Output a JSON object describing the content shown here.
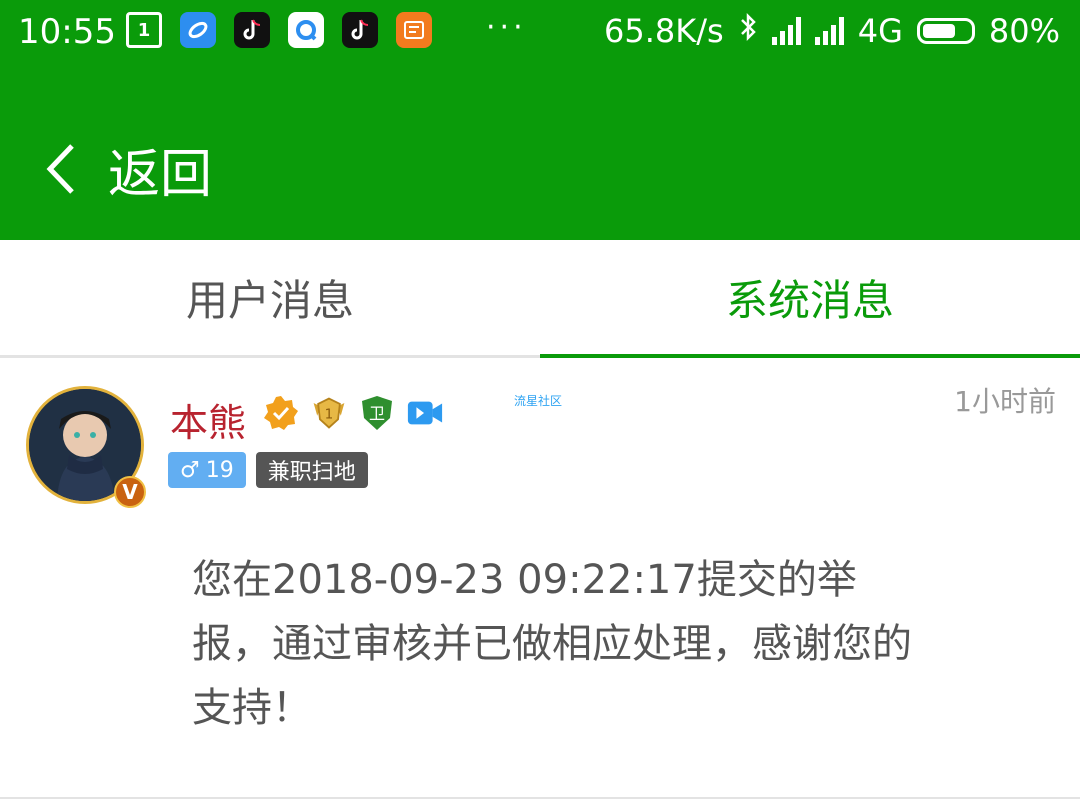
{
  "status_bar": {
    "time": "10:55",
    "notification_icons": [
      "calendar-icon",
      "browser-icon",
      "tiktok-icon",
      "search-app-icon",
      "tiktok-icon",
      "news-app-icon"
    ],
    "calendar_day": "1",
    "more": "···",
    "net_speed": "65.8K/s",
    "network": "4G",
    "battery": "80%",
    "battery_level": 0.8
  },
  "header": {
    "back_label": "返回"
  },
  "tabs": [
    {
      "label": "用户消息",
      "active": false
    },
    {
      "label": "系统消息",
      "active": true
    }
  ],
  "message": {
    "user_name": "本熊",
    "badges": [
      "verified-icon",
      "level-badge-icon",
      "guard-badge-icon",
      "video-badge-icon"
    ],
    "level_number": "1",
    "guard_label": "卫",
    "vip_mark": "V",
    "site_tag": "流星社区",
    "time": "1小时前",
    "gender_symbol": "♂",
    "age": "19",
    "job": "兼职扫地",
    "content": "您在2018-09-23 09:22:17提交的举报，通过审核并已做相应处理，感谢您的支持！"
  },
  "colors": {
    "brand": "#0a9b0a",
    "username": "#b8232f",
    "gender_tag": "#62aef2",
    "job_tag": "#555555"
  }
}
